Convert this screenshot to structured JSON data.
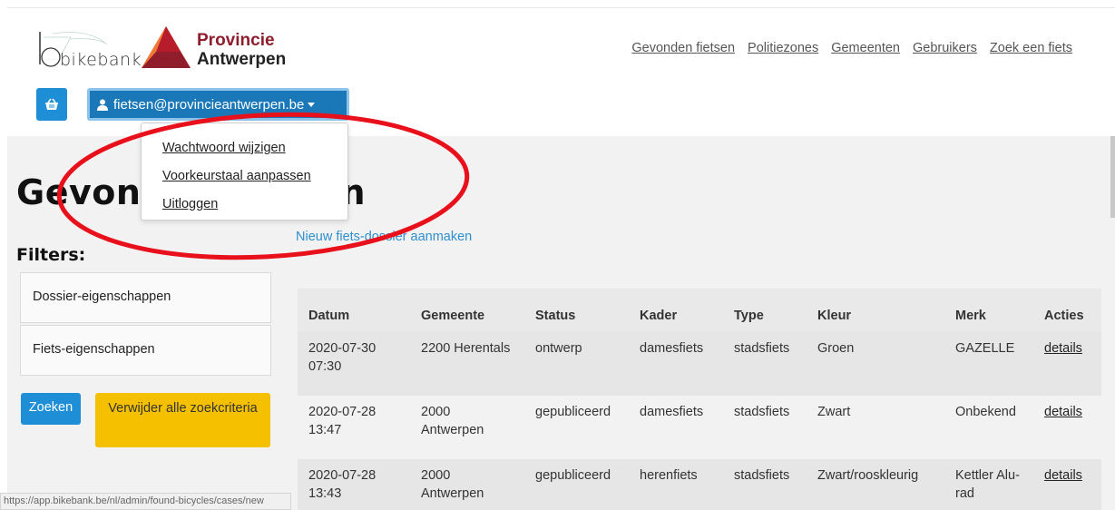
{
  "logos": {
    "bikebank": "bikebank",
    "provincie_line1": "Provincie",
    "provincie_line2": "Antwerpen"
  },
  "nav": {
    "items": [
      "Gevonden fietsen",
      "Politiezones",
      "Gemeenten",
      "Gebruikers",
      "Zoek een fiets"
    ]
  },
  "user_menu": {
    "email": "fietsen@provincieantwerpen.be",
    "items": [
      "Wachtwoord wijzigen",
      "Voorkeurstaal aanpassen",
      "Uitloggen"
    ]
  },
  "page": {
    "title": "Gevonden fietsen",
    "filters_heading": "Filters:",
    "new_link": "Nieuw fiets-dossier aanmaken"
  },
  "filters": {
    "panels": [
      "Dossier-eigenschappen",
      "Fiets-eigenschappen"
    ],
    "search_label": "Zoeken",
    "clear_label": "Verwijder alle zoekcriteria"
  },
  "table": {
    "headers": [
      "Datum",
      "Gemeente",
      "Status",
      "Kader",
      "Type",
      "Kleur",
      "Merk",
      "Acties"
    ],
    "rows": [
      [
        "2020-07-30 07:30",
        "2200 Herentals",
        "ontwerp",
        "damesfiets",
        "stadsfiets",
        "Groen",
        "GAZELLE",
        "details"
      ],
      [
        "2020-07-28 13:47",
        "2000 Antwerpen",
        "gepubliceerd",
        "damesfiets",
        "stadsfiets",
        "Zwart",
        "Onbekend",
        "details"
      ],
      [
        "2020-07-28 13:43",
        "2000 Antwerpen",
        "gepubliceerd",
        "herenfiets",
        "stadsfiets",
        "Zwart/rooskleurig",
        "Kettler Alu-rad",
        "details"
      ]
    ]
  },
  "statusbar": {
    "url": "https://app.bikebank.be/nl/admin/found-bicycles/cases/new"
  },
  "colors": {
    "primary": "#1e8fd6",
    "primary_dark": "#1a78b8",
    "warning": "#f5c000",
    "brand_red": "#8f1d2c",
    "annotation": "#e8101a"
  }
}
